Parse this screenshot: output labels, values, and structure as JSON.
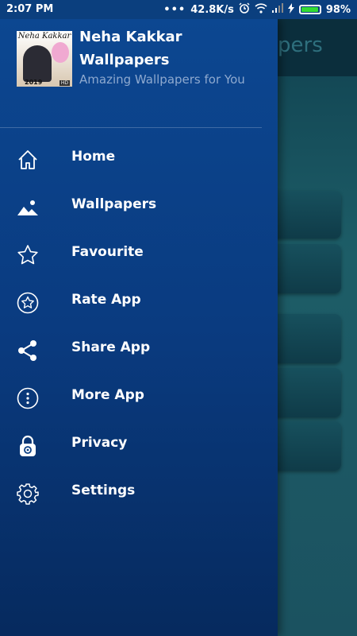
{
  "status_bar": {
    "time": "2:07 PM",
    "dots": "•••",
    "network_speed": "42.8K/s",
    "battery_percent": "98%",
    "battery_level": 0.98
  },
  "background_app": {
    "title_fragment": "pers"
  },
  "drawer": {
    "app_icon": {
      "icon_text": "Neha Kakkar",
      "year": "2019",
      "badge": "HD"
    },
    "app_name": "Neha Kakkar Wallpapers",
    "tagline": "Amazing Wallpapers for You",
    "menu": [
      {
        "label": "Home",
        "icon": "home-icon"
      },
      {
        "label": "Wallpapers",
        "icon": "image-icon"
      },
      {
        "label": "Favourite",
        "icon": "star-icon"
      },
      {
        "label": "Rate App",
        "icon": "rate-star-circle-icon"
      },
      {
        "label": "Share App",
        "icon": "share-icon"
      },
      {
        "label": "More App",
        "icon": "more-vertical-icon"
      },
      {
        "label": "Privacy",
        "icon": "privacy-lock-icon"
      },
      {
        "label": "Settings",
        "icon": "gear-icon"
      }
    ]
  },
  "colors": {
    "drawer_top": "#0c4791",
    "drawer_bottom": "#062a5e",
    "tagline": "#8ea9cf",
    "battery_fill": "#33dd33"
  }
}
